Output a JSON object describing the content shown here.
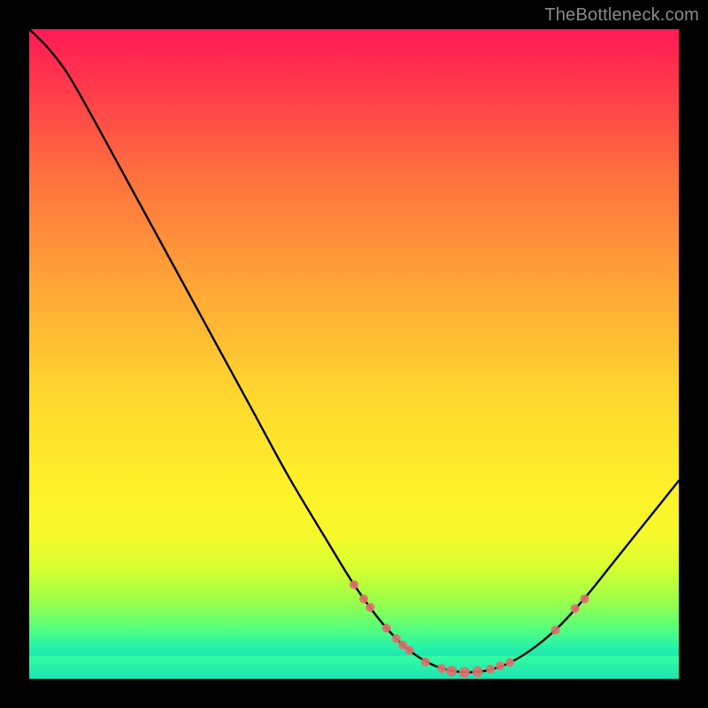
{
  "watermark": "TheBottleneck.com",
  "colors": {
    "curve_stroke": "#000000",
    "marker_fill": "#e06f6f",
    "gradient_top": "#ff1a54",
    "gradient_bottom": "#18d4b4"
  },
  "chart_data": {
    "type": "line",
    "title": "",
    "xlabel": "",
    "ylabel": "",
    "xlim": [
      0,
      100
    ],
    "ylim": [
      0,
      100
    ],
    "grid": false,
    "legend": false,
    "note": "Values are percentage of plot width/height, y=0 at bottom. Curve is a V-shaped valley chart. Markers are dots on the curve cluster near the bottom and on the right ascent.",
    "curve": [
      {
        "x": 0.0,
        "y": 100.0
      },
      {
        "x": 3.0,
        "y": 97.0
      },
      {
        "x": 6.0,
        "y": 93.0
      },
      {
        "x": 10.0,
        "y": 86.0
      },
      {
        "x": 16.0,
        "y": 75.0
      },
      {
        "x": 22.0,
        "y": 64.0
      },
      {
        "x": 28.0,
        "y": 53.0
      },
      {
        "x": 34.0,
        "y": 42.0
      },
      {
        "x": 40.0,
        "y": 31.0
      },
      {
        "x": 46.0,
        "y": 21.0
      },
      {
        "x": 50.0,
        "y": 14.5
      },
      {
        "x": 54.0,
        "y": 9.0
      },
      {
        "x": 58.0,
        "y": 4.8
      },
      {
        "x": 62.0,
        "y": 2.2
      },
      {
        "x": 66.0,
        "y": 1.1
      },
      {
        "x": 70.0,
        "y": 1.2
      },
      {
        "x": 74.0,
        "y": 2.5
      },
      {
        "x": 78.0,
        "y": 5.0
      },
      {
        "x": 82.0,
        "y": 8.5
      },
      {
        "x": 86.0,
        "y": 13.0
      },
      {
        "x": 90.0,
        "y": 18.0
      },
      {
        "x": 94.0,
        "y": 23.0
      },
      {
        "x": 98.0,
        "y": 28.0
      },
      {
        "x": 100.0,
        "y": 30.5
      }
    ],
    "markers": [
      {
        "x": 50.0,
        "y": 14.5,
        "r": 5
      },
      {
        "x": 51.5,
        "y": 12.3,
        "r": 5
      },
      {
        "x": 52.5,
        "y": 11.0,
        "r": 5
      },
      {
        "x": 55.0,
        "y": 7.8,
        "r": 5
      },
      {
        "x": 56.5,
        "y": 6.2,
        "r": 5
      },
      {
        "x": 57.5,
        "y": 5.2,
        "r": 5
      },
      {
        "x": 58.5,
        "y": 4.4,
        "r": 5
      },
      {
        "x": 61.0,
        "y": 2.6,
        "r": 5
      },
      {
        "x": 63.5,
        "y": 1.6,
        "r": 5
      },
      {
        "x": 65.0,
        "y": 1.2,
        "r": 6
      },
      {
        "x": 67.0,
        "y": 1.0,
        "r": 6
      },
      {
        "x": 69.0,
        "y": 1.1,
        "r": 6
      },
      {
        "x": 71.0,
        "y": 1.5,
        "r": 5
      },
      {
        "x": 72.5,
        "y": 2.0,
        "r": 5
      },
      {
        "x": 74.0,
        "y": 2.5,
        "r": 5
      },
      {
        "x": 81.0,
        "y": 7.5,
        "r": 5
      },
      {
        "x": 84.0,
        "y": 10.8,
        "r": 5
      },
      {
        "x": 85.5,
        "y": 12.3,
        "r": 5
      }
    ]
  }
}
